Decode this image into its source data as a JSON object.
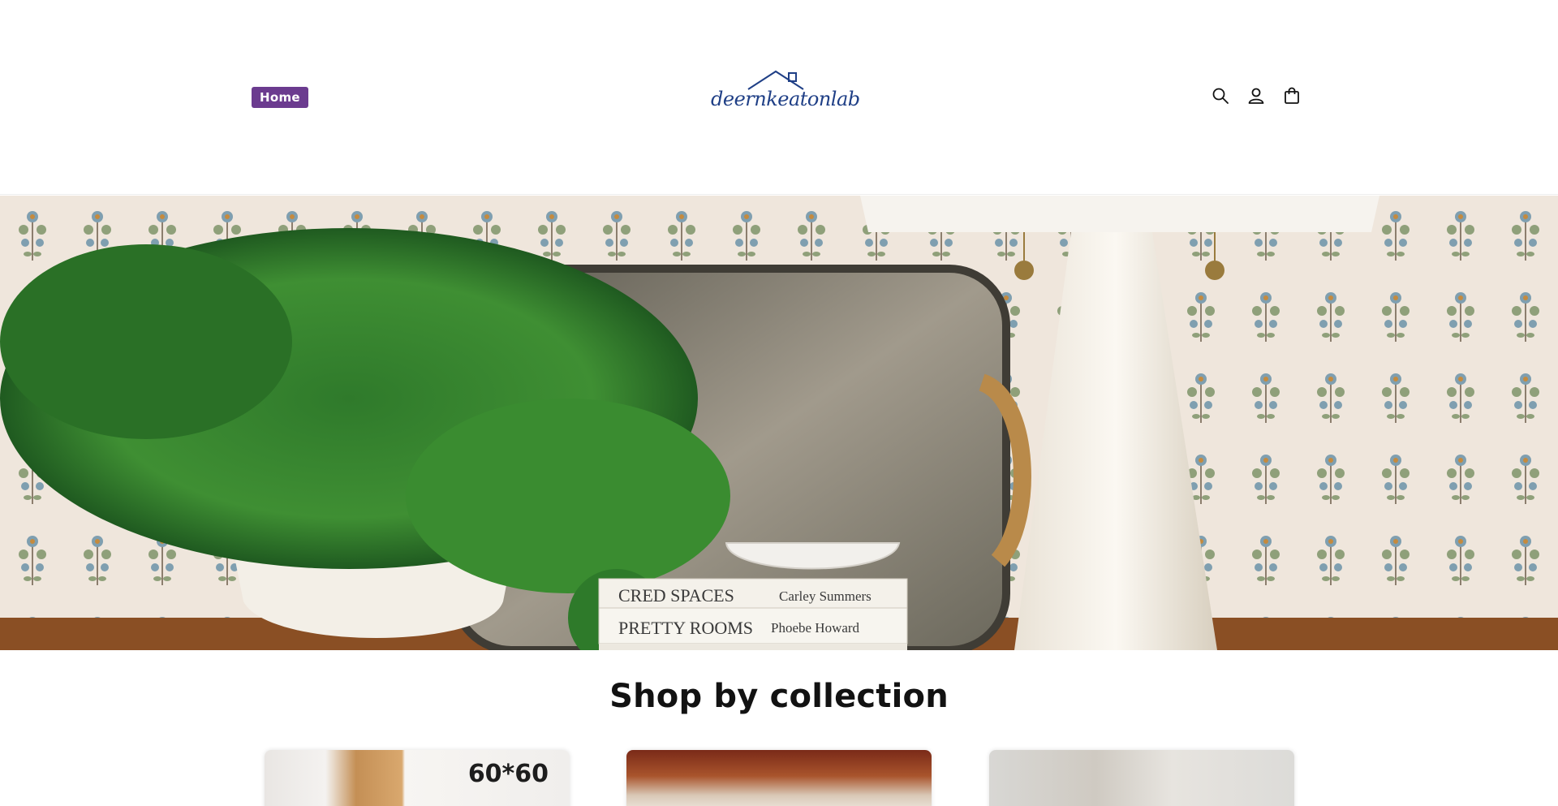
{
  "header": {
    "nav": {
      "home_label": "Home"
    },
    "logo_text": "deernkeatonlab",
    "icons": [
      "search-icon",
      "account-icon",
      "cart-icon"
    ]
  },
  "hero": {
    "image": "hero-banner-image",
    "book_titles": [
      "CRED SPACES",
      "Carley Summers",
      "PRETTY ROOMS",
      "Phoebe Howard"
    ]
  },
  "collection": {
    "title": "Shop by collection",
    "cards": [
      {
        "badge": "60*60"
      },
      {
        "badge": ""
      },
      {
        "badge": ""
      }
    ]
  },
  "colors": {
    "accent": "#6b3b8f",
    "logo": "#1f3f86",
    "text": "#121212"
  }
}
